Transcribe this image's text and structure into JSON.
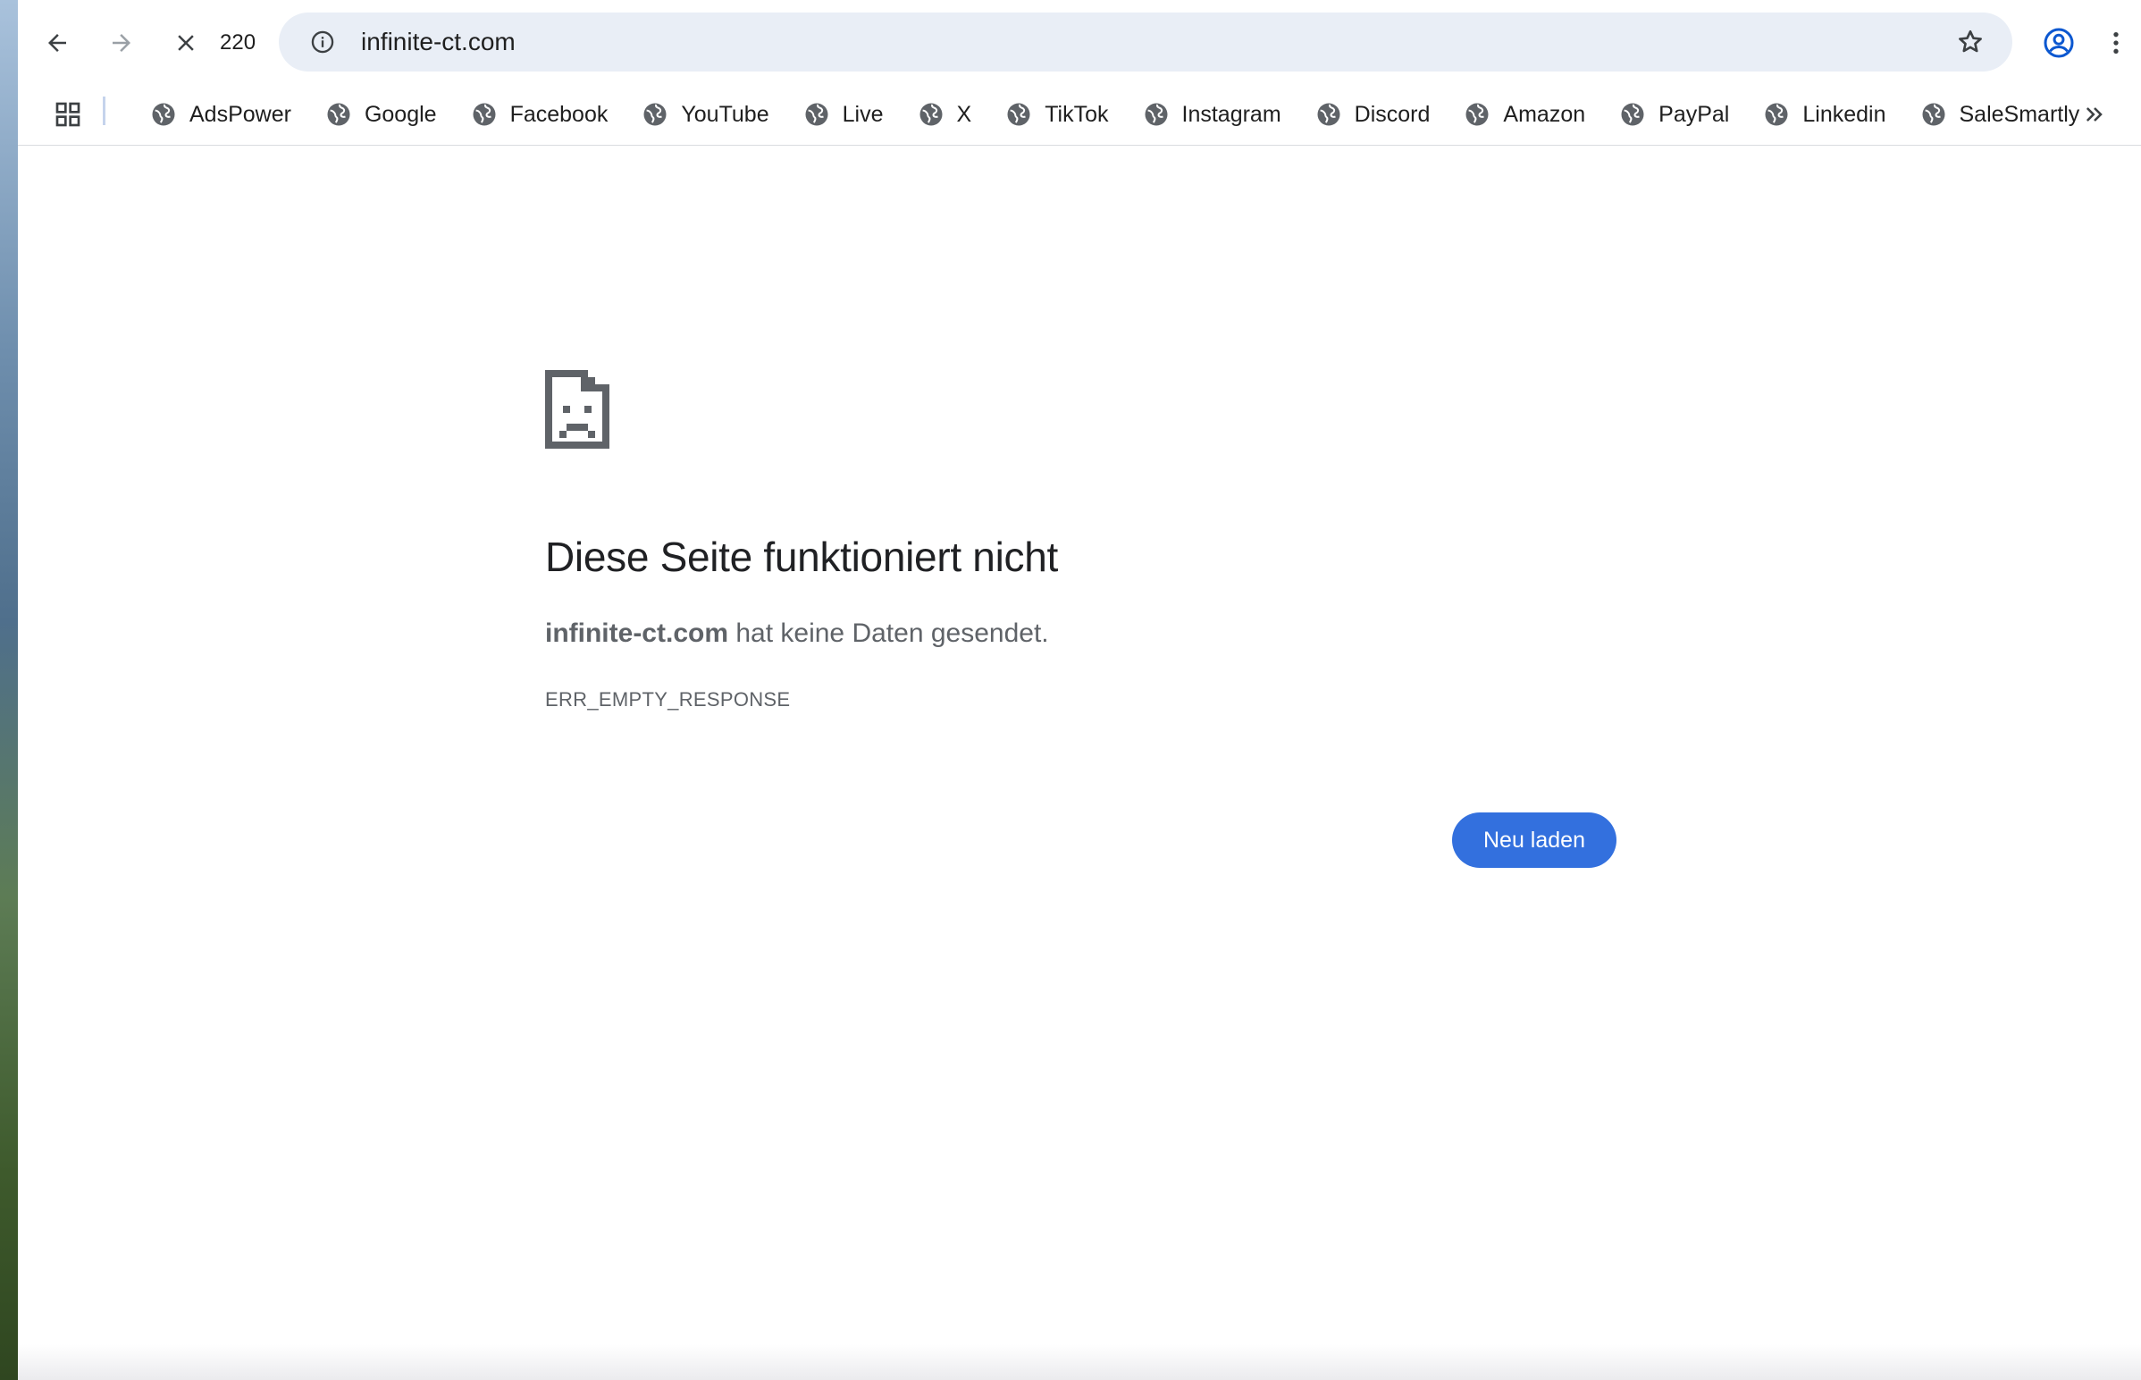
{
  "toolbar": {
    "tab_count": "220",
    "url": "infinite-ct.com"
  },
  "bookmarks": [
    {
      "label": "AdsPower"
    },
    {
      "label": "Google"
    },
    {
      "label": "Facebook"
    },
    {
      "label": "YouTube"
    },
    {
      "label": "Live"
    },
    {
      "label": "X"
    },
    {
      "label": "TikTok"
    },
    {
      "label": "Instagram"
    },
    {
      "label": "Discord"
    },
    {
      "label": "Amazon"
    },
    {
      "label": "PayPal"
    },
    {
      "label": "Linkedin"
    },
    {
      "label": "SaleSmartly"
    }
  ],
  "error": {
    "title": "Diese Seite funktioniert nicht",
    "host": "infinite-ct.com",
    "message": " hat keine Daten gesendet.",
    "code": "ERR_EMPTY_RESPONSE",
    "reload_label": "Neu laden"
  },
  "colors": {
    "accent": "#3370de",
    "omnibox_bg": "#e9eef6",
    "text_primary": "#202124",
    "text_secondary": "#5f6368"
  },
  "icons": {
    "back": "arrow-left-icon",
    "forward": "arrow-right-icon",
    "stop": "close-icon",
    "site_info": "info-icon",
    "bookmark_star": "star-icon",
    "profile": "account-circle-icon",
    "menu": "more-vertical-icon",
    "apps": "apps-grid-icon",
    "bookmark_favicon": "globe-icon",
    "overflow": "chevron-double-right-icon",
    "error_page": "sad-document-icon"
  }
}
